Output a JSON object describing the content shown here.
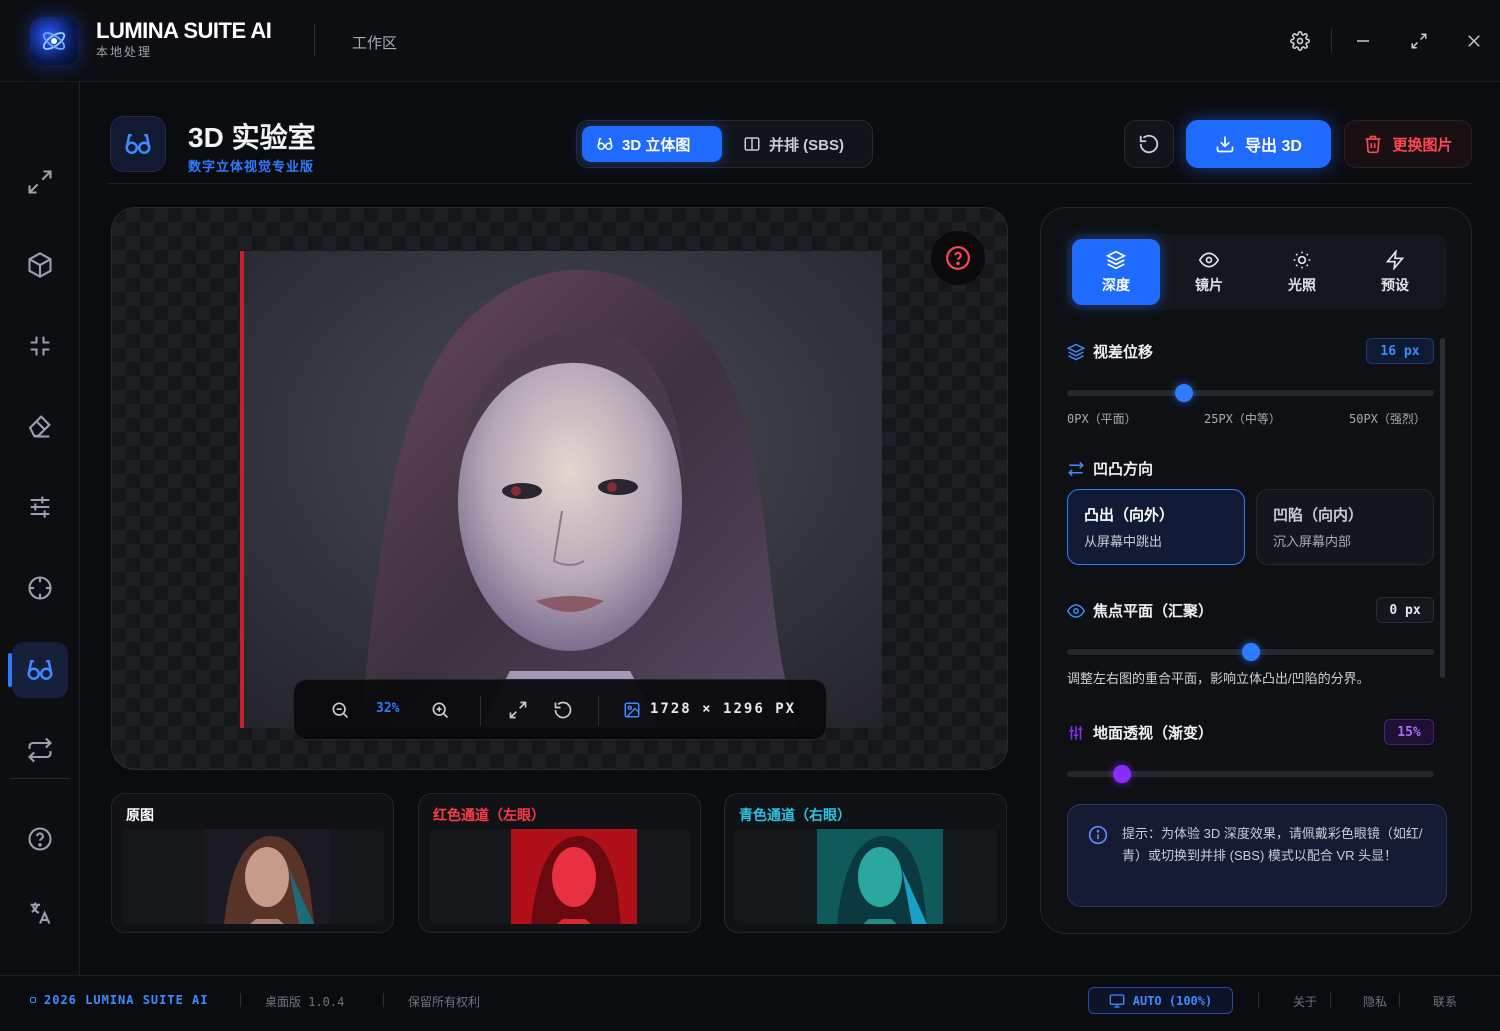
{
  "app": {
    "name": "LUMINA SUITE AI",
    "subtitle": "本地处理",
    "workspace": "工作区"
  },
  "sidebar": {
    "items": [
      {
        "icon": "expand-icon"
      },
      {
        "icon": "cube-icon"
      },
      {
        "icon": "compress-icon"
      },
      {
        "icon": "eraser-icon"
      },
      {
        "icon": "sliders-icon"
      },
      {
        "icon": "crosshair-icon"
      },
      {
        "icon": "glasses-3d-icon",
        "active": true
      },
      {
        "icon": "swap-icon"
      },
      {
        "icon": "help-icon"
      },
      {
        "icon": "translate-icon"
      }
    ]
  },
  "header": {
    "title": "3D 实验室",
    "subtitle": "数字立体视觉专业版",
    "mode_tabs": [
      {
        "label": "3D 立体图",
        "icon": "glasses-3d-icon",
        "active": true
      },
      {
        "label": "并排 (SBS)",
        "icon": "columns-icon",
        "active": false
      }
    ],
    "export_label": "导出 3D",
    "replace_label": "更换图片"
  },
  "canvas": {
    "zoom": "32%",
    "width": "1728",
    "times": "×",
    "height": "1296",
    "unit": "PX"
  },
  "thumbnails": [
    {
      "label": "原图",
      "color": "#ffffff"
    },
    {
      "label": "红色通道（左眼）",
      "color": "#ff3b4a"
    },
    {
      "label": "青色通道（右眼）",
      "color": "#2ec4e8"
    }
  ],
  "panel": {
    "tabs": [
      {
        "label": "深度",
        "icon": "layers-icon",
        "active": true
      },
      {
        "label": "镜片",
        "icon": "eye-icon",
        "active": false
      },
      {
        "label": "光照",
        "icon": "sun-icon",
        "active": false
      },
      {
        "label": "预设",
        "icon": "bolt-icon",
        "active": false
      }
    ],
    "parallax": {
      "label": "视差位移",
      "value": "16 px",
      "level": 0.32,
      "ticks": [
        "0PX（平面）",
        "25PX（中等）",
        "50PX（强烈）"
      ]
    },
    "direction": {
      "label": "凹凸方向",
      "options": [
        {
          "title": "凸出（向外）",
          "sub": "从屏幕中跳出",
          "active": true
        },
        {
          "title": "凹陷（向内）",
          "sub": "沉入屏幕内部",
          "active": false
        }
      ]
    },
    "focal": {
      "label": "焦点平面（汇聚）",
      "value": "0 px",
      "level": 0.5,
      "desc": "调整左右图的重合平面，影响立体凸出/凹陷的分界。"
    },
    "ground": {
      "label": "地面透视（渐变）",
      "value": "15%",
      "level": 0.15
    },
    "tip": "提示：为体验 3D 深度效果，请佩戴彩色眼镜（如红/青）或切换到并排 (SBS) 模式以配合 VR 头显！"
  },
  "footer": {
    "brand": "2026 LUMINA SUITE AI",
    "version": "桌面版 1.0.4",
    "rights": "保留所有权利",
    "display": "AUTO (100%)",
    "links": [
      "关于",
      "隐私",
      "联系"
    ]
  },
  "colors": {
    "accent": "#1f6bff",
    "danger": "#ff4757",
    "purple": "#8b2cff"
  }
}
